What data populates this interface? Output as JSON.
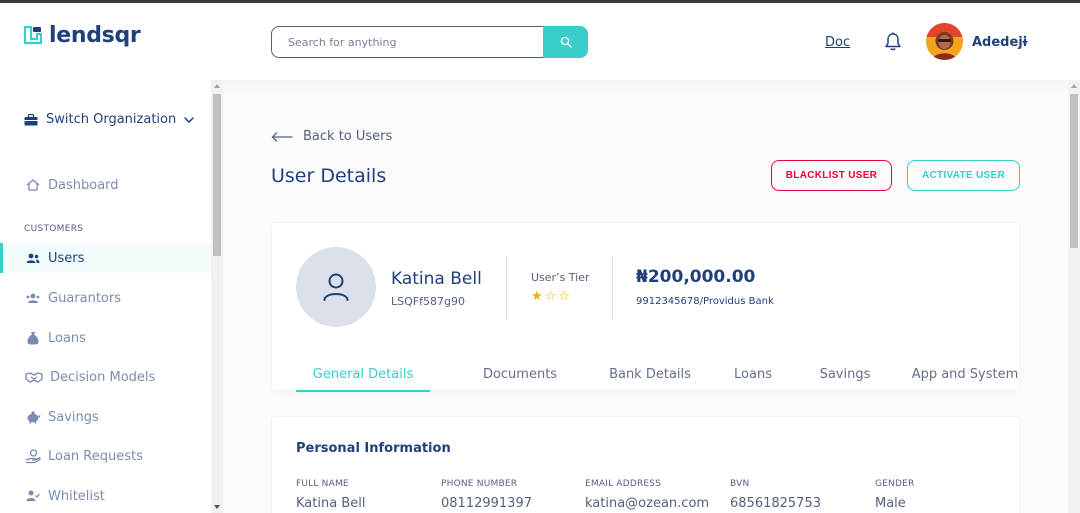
{
  "header": {
    "brand": "lendsqr",
    "search_placeholder": "Search for anything",
    "doc_label": "Doc",
    "user_name": "Adedeji"
  },
  "sidebar": {
    "switch_org": "Switch Organization",
    "dashboard": "Dashboard",
    "section_customers": "CUSTOMERS",
    "items": [
      {
        "label": "Users",
        "icon": "users-icon"
      },
      {
        "label": "Guarantors",
        "icon": "guarantors-icon"
      },
      {
        "label": "Loans",
        "icon": "sack-icon"
      },
      {
        "label": "Decision Models",
        "icon": "handshake-icon"
      },
      {
        "label": "Savings",
        "icon": "piggy-bank-icon"
      },
      {
        "label": "Loan Requests",
        "icon": "loan-request-icon"
      },
      {
        "label": "Whitelist",
        "icon": "user-check-icon"
      }
    ]
  },
  "main": {
    "back_label": "Back to Users",
    "title": "User Details",
    "blacklist_label": "BLACKLIST USER",
    "activate_label": "ACTIVATE USER"
  },
  "profile": {
    "name": "Katina Bell",
    "id": "LSQFf587g90",
    "tier_label": "User’s Tier",
    "tier": 1,
    "tier_max": 3,
    "balance": "₦200,000.00",
    "bank": "9912345678/Providus Bank",
    "tabs": [
      "General Details",
      "Documents",
      "Bank Details",
      "Loans",
      "Savings",
      "App and System"
    ],
    "active_tab": "General Details"
  },
  "personal_info": {
    "title": "Personal Information",
    "fields": [
      {
        "label": "FULL NAME",
        "value": "Katina Bell"
      },
      {
        "label": "PHONE NUMBER",
        "value": "08112991397"
      },
      {
        "label": "EMAIL ADDRESS",
        "value": "katina@ozean.com"
      },
      {
        "label": "BVN",
        "value": "68561825753"
      },
      {
        "label": "GENDER",
        "value": "Male"
      }
    ]
  },
  "colors": {
    "primary": "#213f7d",
    "accent": "#39cdcc",
    "danger": "#e4033b",
    "star": "#e9b200"
  }
}
